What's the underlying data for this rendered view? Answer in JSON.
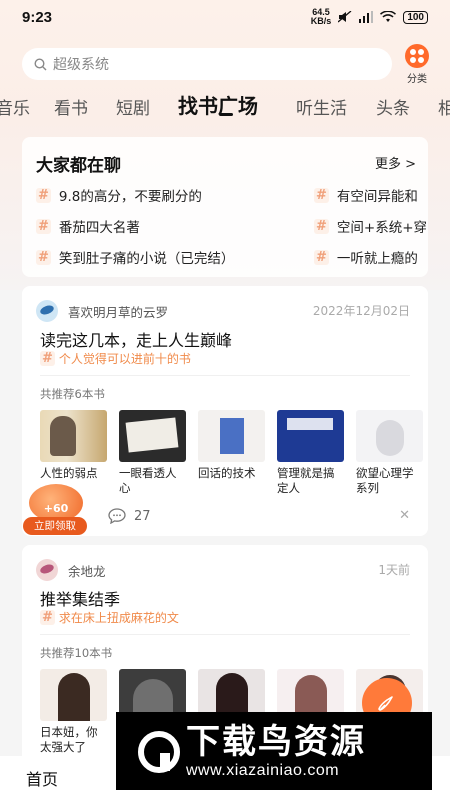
{
  "status_bar": {
    "time": "9:23",
    "speed_value": "64.5",
    "speed_unit": "KB/s",
    "battery": "100"
  },
  "search": {
    "placeholder": "超级系统",
    "category_label": "分类"
  },
  "tabs": [
    "音乐",
    "看书",
    "短剧",
    "找书广场",
    "听生活",
    "头条",
    "相"
  ],
  "active_tab": "找书广场",
  "chat": {
    "title": "大家都在聊",
    "more_label": "更多 >",
    "items": [
      "9.8的高分，不要刷分的",
      "番茄四大名著",
      "笑到肚子痛的小说（已完结）",
      "有空间异能和",
      "空间+系统+穿",
      "一听就上瘾的"
    ]
  },
  "posts": [
    {
      "user": "喜欢明月草的云罗",
      "date": "2022年12月02日",
      "title": "读完这几本，走上人生巅峰",
      "tag": "个人觉得可以进前十的书",
      "rec_label": "共推荐6本书",
      "books": [
        "人性的弱点",
        "一眼看透人心",
        "回话的技术",
        "管理就是搞定人",
        "欲望心理学系列"
      ],
      "comments": "27"
    },
    {
      "user": "余地龙",
      "date": "1天前",
      "title": "推举集结季",
      "tag": "求在床上扭成麻花的文",
      "rec_label": "共推荐10本书",
      "books": [
        "日本妞，你太强大了"
      ]
    }
  ],
  "bonus": {
    "amount": "+60",
    "label": "立即领取"
  },
  "bottom_nav": {
    "home": "首页"
  },
  "watermark": {
    "name": "下载鸟资源",
    "url": "www.xiazainiao.com"
  },
  "colors": {
    "accent": "#ff6a2b",
    "tag": "#f08a4a"
  }
}
